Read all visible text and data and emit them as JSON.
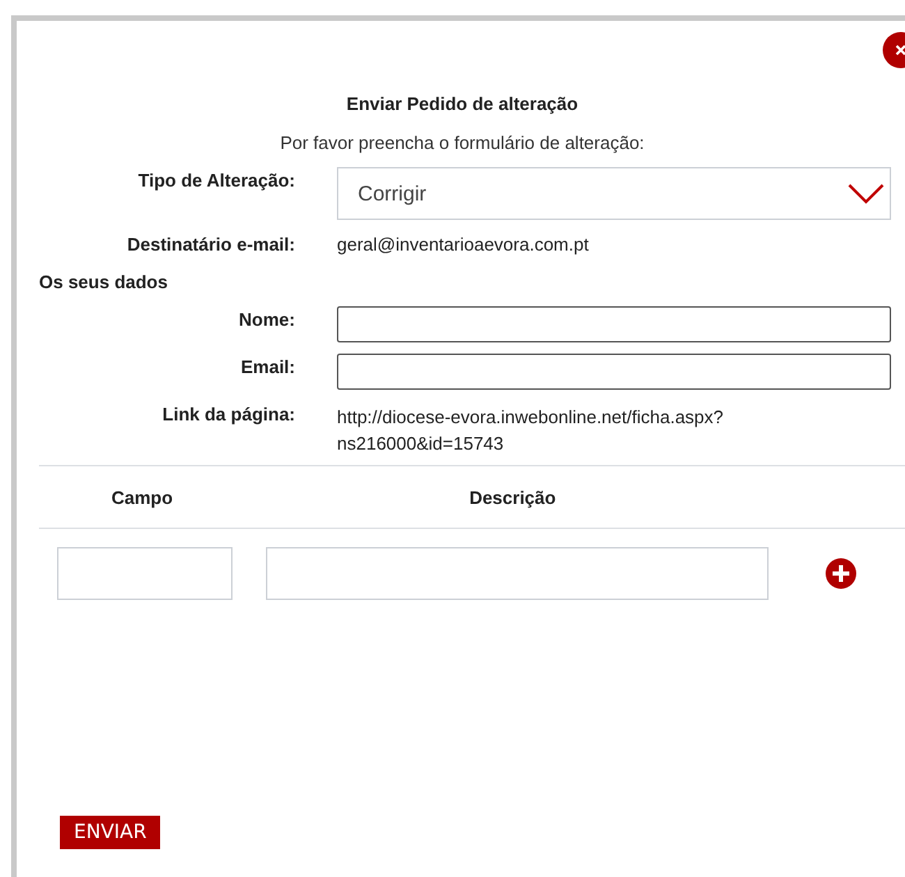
{
  "title": "Enviar Pedido de alteração",
  "subtitle": "Por favor preencha o formulário de alteração:",
  "change_type": {
    "label": "Tipo de Alteração:",
    "value": "Corrigir"
  },
  "recipient": {
    "label": "Destinatário e-mail:",
    "value": "geral@inventarioaevora.com.pt"
  },
  "section": "Os seus dados",
  "fields": [
    {
      "label": "Nome:"
    },
    {
      "label": "Email:"
    }
  ],
  "page_link": {
    "label": "Link da página:",
    "lines": [
      "http://diocese-evora.inwebonline.net/ficha.aspx?",
      "ns216000&id=15743"
    ]
  },
  "columns": [
    "Campo",
    "Descrição"
  ],
  "submit": "ENVIAR"
}
